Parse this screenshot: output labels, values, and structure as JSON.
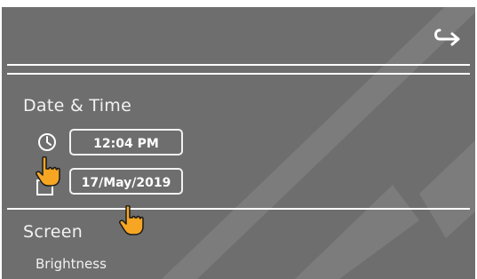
{
  "header": {
    "back_icon": "return-arrow-icon"
  },
  "date_time": {
    "title": "Date & Time",
    "time_value": "12:04 PM",
    "date_value": "17/May/2019",
    "time_icon": "clock-icon",
    "date_icon": "calendar-icon"
  },
  "screen": {
    "title": "Screen",
    "brightness_label": "Brightness"
  },
  "colors": {
    "panel_background": "#6e6e6e",
    "text": "#f2f2f2",
    "cursor_fill": "#f6a623"
  }
}
